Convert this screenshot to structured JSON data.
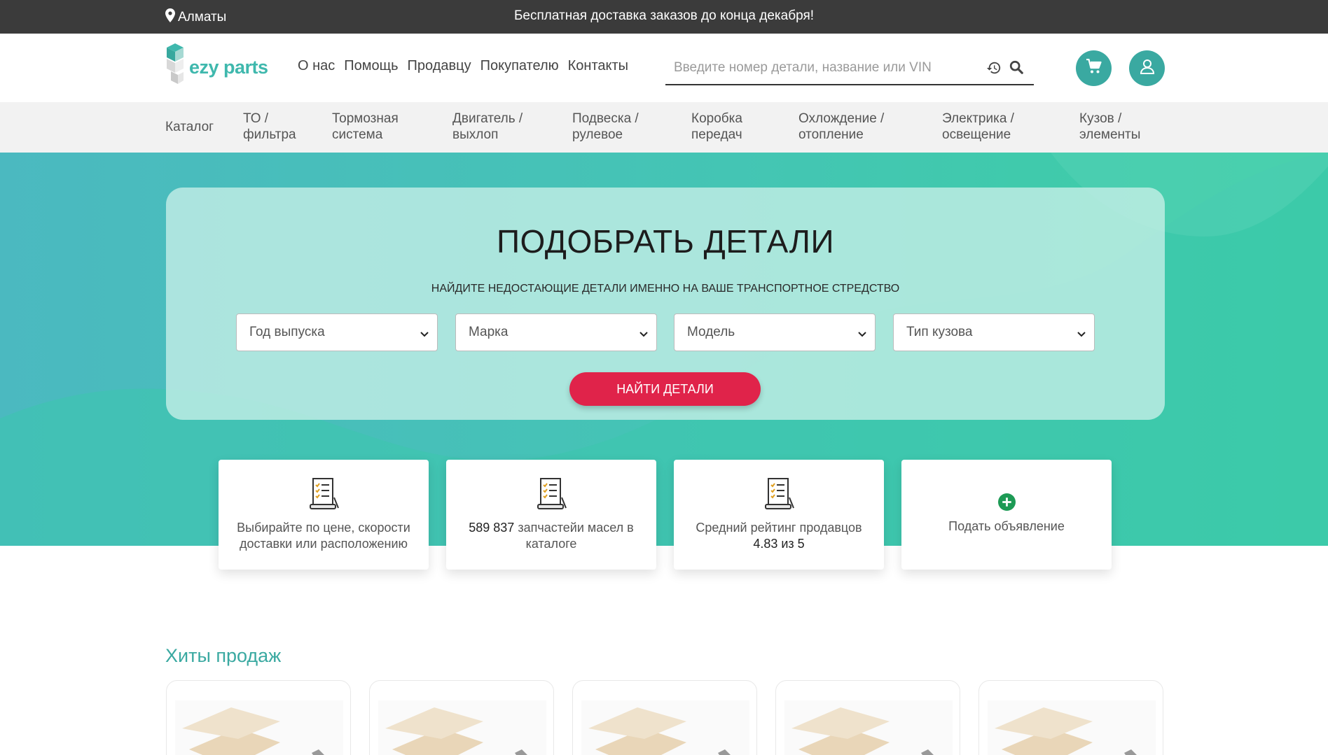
{
  "topbar": {
    "city": "Алматы",
    "promo": "Бесплатная доставка заказов до конца декабря!"
  },
  "header": {
    "logo_text": "ezy parts",
    "nav": [
      "О нас",
      "Помощь",
      "Продавцу",
      "Покупателю",
      "Контакты"
    ],
    "search_placeholder": "Введите номер детали, название или VIN"
  },
  "categories": {
    "catalog": "Каталог",
    "items": [
      {
        "line1": "ТО /",
        "line2": "фильтра"
      },
      {
        "line1": "Тормозная",
        "line2": "система"
      },
      {
        "line1": "Двигатель /",
        "line2": "выхлоп"
      },
      {
        "line1": "Подвеска /",
        "line2": "рулевое"
      },
      {
        "line1": "Коробка",
        "line2": "передач"
      },
      {
        "line1": "Охлождение /",
        "line2": "отопление"
      },
      {
        "line1": "Электрика /",
        "line2": "освещение"
      },
      {
        "line1": "Кузов /",
        "line2": "элементы"
      }
    ]
  },
  "hero": {
    "title": "ПОДОБРАТЬ ДЕТАЛИ",
    "subtitle": "НАЙДИТЕ НЕДОСТАЮЩИЕ ДЕТАЛИ ИМЕННО НА ВАШЕ ТРАНСПОРТНОЕ СТРЕДСТВО",
    "selects": [
      "Год выпуска",
      "Марка",
      "Модель",
      "Тип кузова"
    ],
    "button": "НАЙТИ ДЕТАЛИ"
  },
  "features": [
    {
      "line1": "Выбирайте по цене, скорости",
      "line2": "доставки или расположению"
    },
    {
      "number": "589 837",
      "line1": " запчастейи масел в",
      "line2": "каталоге"
    },
    {
      "line1": "Средний рейтинг продавцов",
      "rating": "4.83 из 5"
    },
    {
      "line1": "Подать объявление"
    }
  ],
  "hits": {
    "title": "Хиты продаж"
  },
  "colors": {
    "accent": "#3aa9a1",
    "button": "#e0234a",
    "topbar": "#3b3b3b"
  }
}
